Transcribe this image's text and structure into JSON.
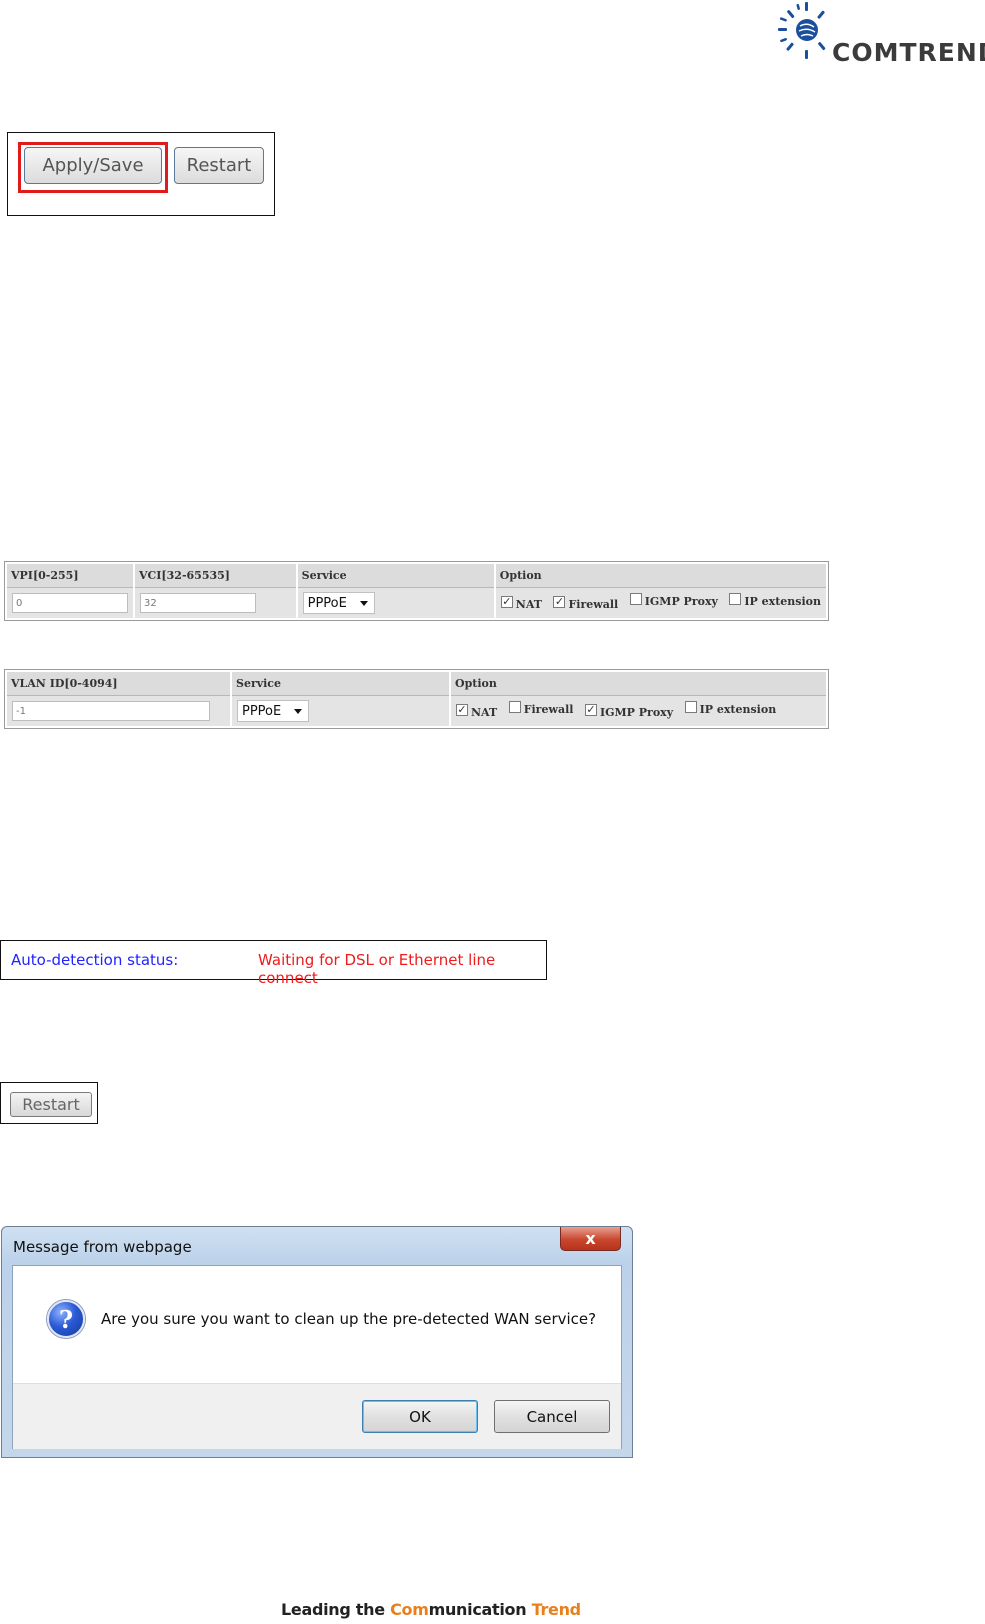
{
  "logo": {
    "brand": "COMTREND",
    "icon": "comtrend-starburst-icon"
  },
  "apply_panel": {
    "apply_label": "Apply/Save",
    "restart_label": "Restart"
  },
  "atm_table": {
    "headers": [
      "VPI[0-255]",
      "VCI[32-65535]",
      "Service",
      "Option"
    ],
    "vpi_value": "0",
    "vci_value": "32",
    "service_value": "PPPoE",
    "options": [
      {
        "label": "NAT",
        "checked": true
      },
      {
        "label": "Firewall",
        "checked": true
      },
      {
        "label": "IGMP Proxy",
        "checked": false
      },
      {
        "label": "IP extension",
        "checked": false
      }
    ]
  },
  "vlan_table": {
    "headers": [
      "VLAN ID[0-4094]",
      "Service",
      "Option"
    ],
    "vlan_value": "-1",
    "service_value": "PPPoE",
    "options": [
      {
        "label": "NAT",
        "checked": true
      },
      {
        "label": "Firewall",
        "checked": false
      },
      {
        "label": "IGMP Proxy",
        "checked": true
      },
      {
        "label": "IP extension",
        "checked": false
      }
    ]
  },
  "status": {
    "label": "Auto-detection status:",
    "value": "Waiting for DSL or Ethernet line connect",
    "label_color": "#2222ff",
    "value_color": "#ee1c1c"
  },
  "restart_panel": {
    "restart_label": "Restart"
  },
  "dialog": {
    "title": "Message from webpage",
    "close_glyph": "x",
    "icon": "question-icon",
    "message": "Are you sure you want to clean up the pre-detected WAN service?",
    "ok_label": "OK",
    "cancel_label": "Cancel"
  },
  "footer": {
    "part1": "Leading the ",
    "part2": "Com",
    "part3": "munication ",
    "part4": "Trend"
  }
}
